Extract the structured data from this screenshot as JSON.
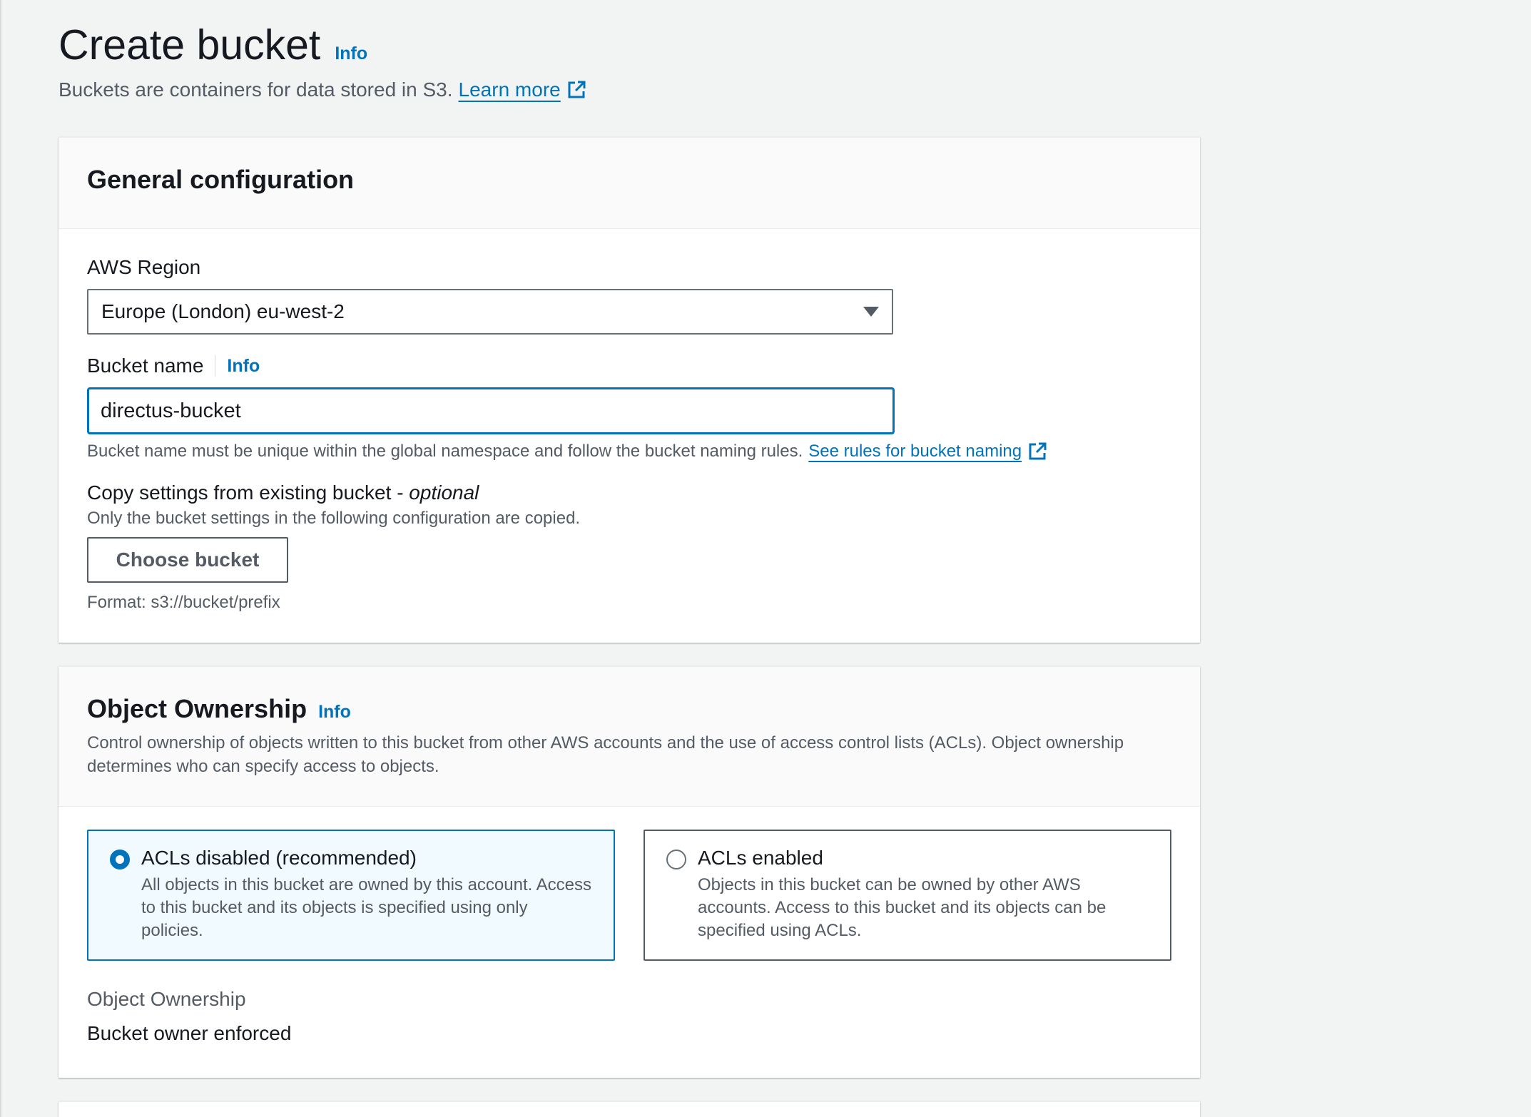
{
  "header": {
    "title": "Create bucket",
    "info_label": "Info",
    "description": "Buckets are containers for data stored in S3.",
    "learn_more_label": "Learn more"
  },
  "general_config": {
    "title": "General configuration",
    "region": {
      "label": "AWS Region",
      "selected": "Europe (London) eu-west-2"
    },
    "bucket_name": {
      "label": "Bucket name",
      "info_label": "Info",
      "value": "directus-bucket",
      "hint": "Bucket name must be unique within the global namespace and follow the bucket naming rules.",
      "rules_link": "See rules for bucket naming"
    },
    "copy_settings": {
      "label_prefix": "Copy settings from existing bucket - ",
      "label_optional": "optional",
      "description": "Only the bucket settings in the following configuration are copied.",
      "button_label": "Choose bucket",
      "format_hint": "Format: s3://bucket/prefix"
    }
  },
  "object_ownership": {
    "title": "Object Ownership",
    "info_label": "Info",
    "description": "Control ownership of objects written to this bucket from other AWS accounts and the use of access control lists (ACLs). Object ownership determines who can specify access to objects.",
    "options": [
      {
        "title": "ACLs disabled (recommended)",
        "description": "All objects in this bucket are owned by this account. Access to this bucket and its objects is specified using only policies.",
        "selected": true
      },
      {
        "title": "ACLs enabled",
        "description": "Objects in this bucket can be owned by other AWS accounts. Access to this bucket and its objects can be specified using ACLs.",
        "selected": false
      }
    ],
    "ownership_key": "Object Ownership",
    "ownership_value": "Bucket owner enforced"
  },
  "colors": {
    "link": "#0073bb",
    "page_bg": "#f2f3f3",
    "selected_tile_bg": "#f1faff"
  },
  "icons": {
    "external_link": "external-link-icon",
    "dropdown": "caret-down-icon"
  }
}
